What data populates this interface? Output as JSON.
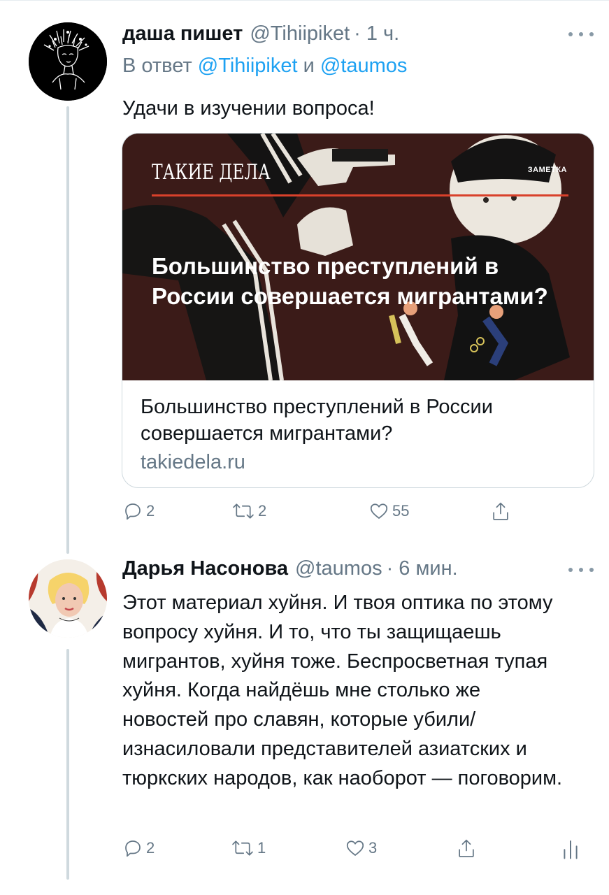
{
  "tweets": [
    {
      "author": "даша пишет",
      "handle": "@Tihiipiket",
      "time": "· 1 ч.",
      "reply_prefix": "В ответ",
      "reply_to_1": "@Tihiipiket",
      "reply_and": "и",
      "reply_to_2": "@taumos",
      "text": "Удачи в изучении вопроса!",
      "card": {
        "brand": "ТАКИЕ ДЕЛА",
        "tag": "ЗАМЕТКА",
        "headline": "Большинство преступлений в России совершается мигрантами?",
        "title": "Большинство преступлений в России совершается мигрантами?",
        "domain": "takiedela.ru"
      },
      "replies": "2",
      "retweets": "2",
      "likes": "55"
    },
    {
      "author": "Дарья Насонова",
      "handle": "@taumos",
      "time": "· 6 мин.",
      "text": "Этот материал хуйня. И твоя оптика по этому вопросу хуйня. И то, что ты защищаешь мигрантов, хуйня тоже. Беспросветная тупая хуйня. Когда найдёшь мне столько же новостей про славян, которые убили/изнасиловали представителей азиатских и тюркских народов, как наоборот — поговорим.",
      "replies": "2",
      "retweets": "1",
      "likes": "3"
    }
  ],
  "colors": {
    "link": "#1da1f2",
    "secondary_text": "#657786",
    "thread_line": "#cfd9de",
    "card_accent": "#d9412b",
    "card_background": "#3a1a17"
  },
  "icons": [
    "reply-icon",
    "retweet-icon",
    "like-icon",
    "share-icon",
    "analytics-icon",
    "more-icon"
  ]
}
